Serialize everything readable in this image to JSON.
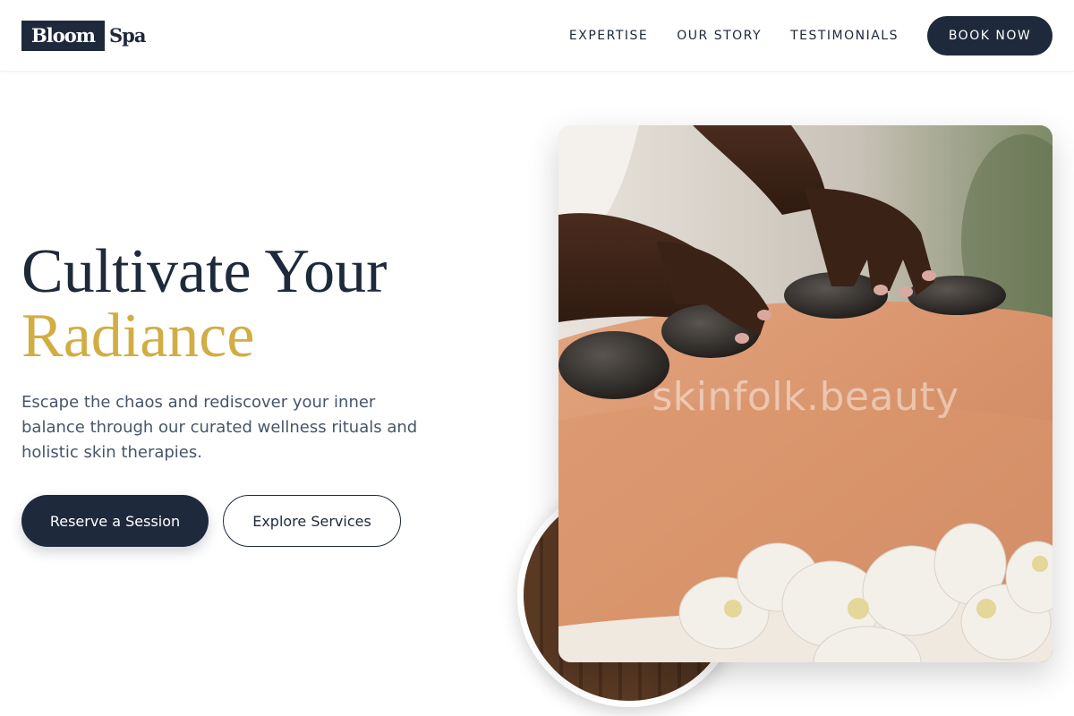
{
  "brand": {
    "logo_box": "Bloom",
    "logo_text": "Spa"
  },
  "nav": {
    "links": [
      "EXPERTISE",
      "OUR STORY",
      "TESTIMONIALS"
    ],
    "cta": "BOOK NOW"
  },
  "hero": {
    "title_line1": "Cultivate Your",
    "title_line2": "Radiance",
    "description": "Escape the chaos and rediscover your inner balance through our curated wellness rituals and holistic skin therapies.",
    "primary_button": "Reserve a Session",
    "secondary_button": "Explore Services"
  },
  "media": {
    "main_image_watermark": "skinfolk.beauty"
  },
  "colors": {
    "navy": "#1e293b",
    "gold": "#d1ad44",
    "body_text": "#475569",
    "background": "#ffffff"
  }
}
